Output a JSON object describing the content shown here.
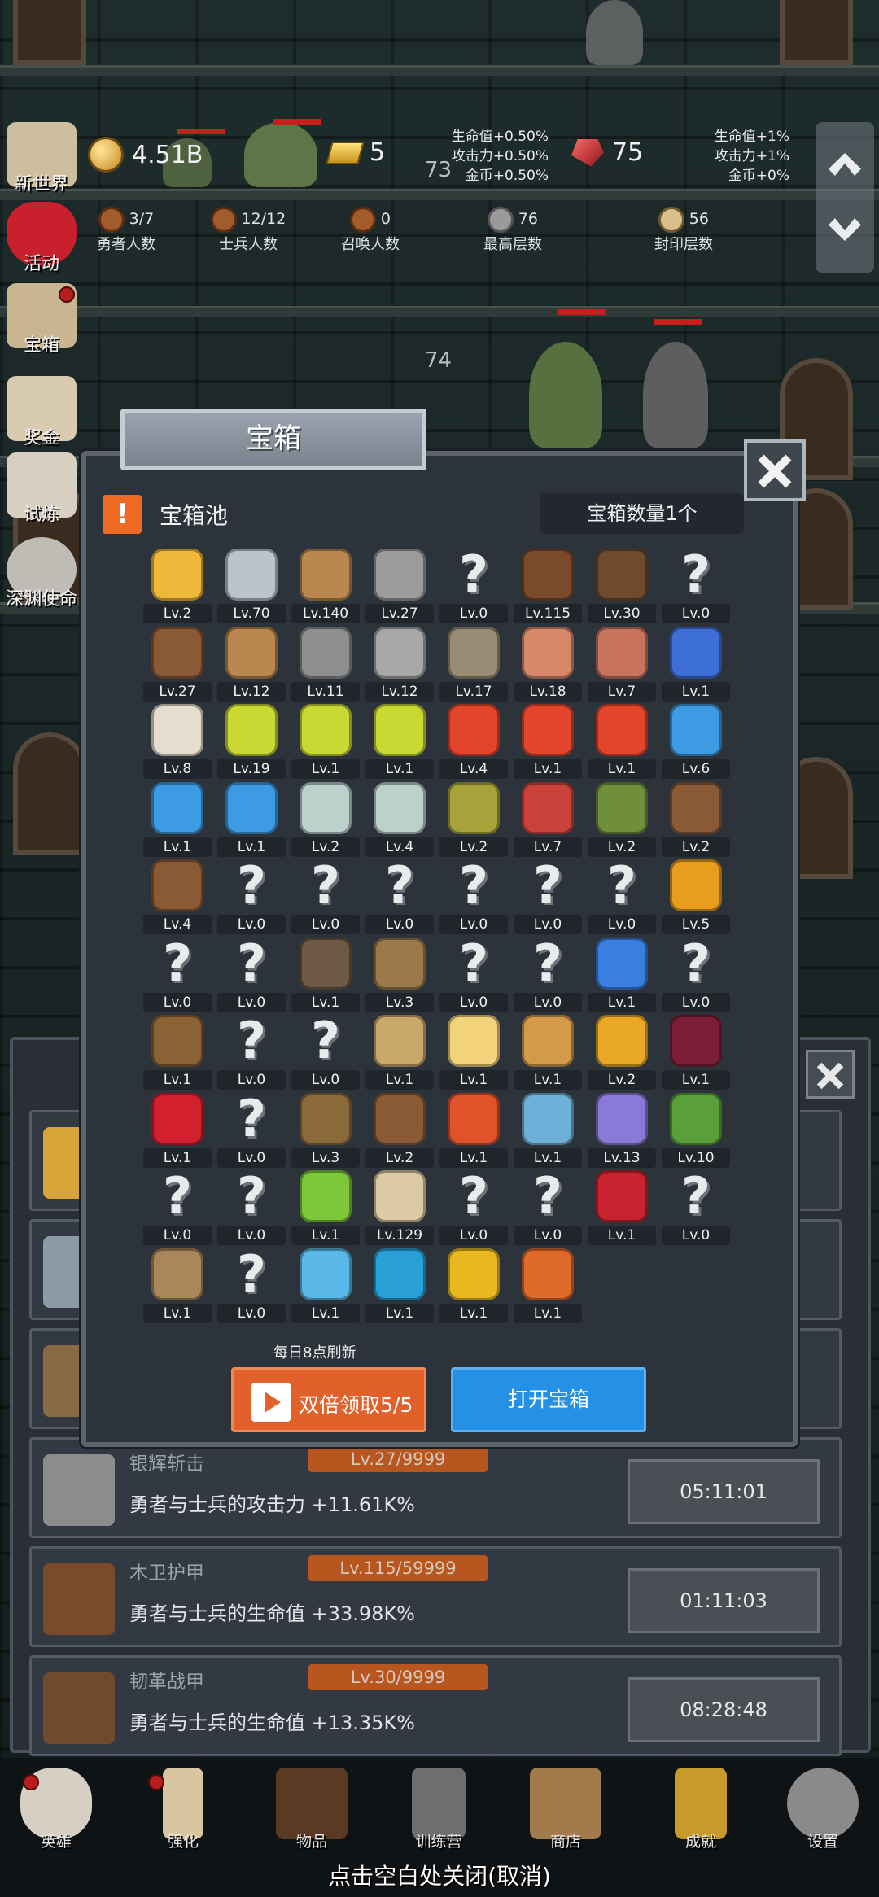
{
  "hud": {
    "gold": "4.51B",
    "gold_bar": "5",
    "gem": "75",
    "floor_top": "73",
    "floor_mid": "74",
    "buffs_left": [
      "生命值+0.50%",
      "攻击力+0.50%",
      "金币+0.50%"
    ],
    "buffs_right": [
      "生命值+1%",
      "攻击力+1%",
      "金币+0%"
    ],
    "stats": [
      {
        "label": "勇者人数",
        "value": "3/7"
      },
      {
        "label": "士兵人数",
        "value": "12/12"
      },
      {
        "label": "召唤人数",
        "value": "0"
      },
      {
        "label": "最高层数",
        "value": "76"
      },
      {
        "label": "封印层数",
        "value": "56"
      }
    ]
  },
  "side_menu": [
    "新世界",
    "活动",
    "宝箱",
    "奖金",
    "试炼",
    "深渊使命"
  ],
  "dialog": {
    "title": "宝箱",
    "pool_label": "宝箱池",
    "pool_icon": "!",
    "count_label": "宝箱数量1个",
    "refresh_note": "每日8点刷新",
    "double_button": "双倍领取5/5",
    "open_button": "打开宝箱",
    "items": [
      {
        "icon": "crown",
        "lv": "Lv.2"
      },
      {
        "icon": "diamond",
        "lv": "Lv.70"
      },
      {
        "icon": "wood-sword",
        "lv": "Lv.140"
      },
      {
        "icon": "silver-sword",
        "lv": "Lv.27"
      },
      {
        "icon": "unknown",
        "lv": "Lv.0"
      },
      {
        "icon": "wood-armor",
        "lv": "Lv.115"
      },
      {
        "icon": "leather-armor",
        "lv": "Lv.30"
      },
      {
        "icon": "unknown",
        "lv": "Lv.0"
      },
      {
        "icon": "leather-helmet",
        "lv": "Lv.27"
      },
      {
        "icon": "wood-sword",
        "lv": "Lv.12"
      },
      {
        "icon": "iron-helmet",
        "lv": "Lv.11"
      },
      {
        "icon": "hammer",
        "lv": "Lv.12"
      },
      {
        "icon": "knight-helmet",
        "lv": "Lv.17"
      },
      {
        "icon": "meat-leg",
        "lv": "Lv.18"
      },
      {
        "icon": "steak",
        "lv": "Lv.7"
      },
      {
        "icon": "blue-bag",
        "lv": "Lv.1"
      },
      {
        "icon": "bread",
        "lv": "Lv.8"
      },
      {
        "icon": "yellow-potion",
        "lv": "Lv.19"
      },
      {
        "icon": "yellow-potion",
        "lv": "Lv.1"
      },
      {
        "icon": "yellow-potion",
        "lv": "Lv.1"
      },
      {
        "icon": "red-potion",
        "lv": "Lv.4"
      },
      {
        "icon": "red-potion",
        "lv": "Lv.1"
      },
      {
        "icon": "red-potion",
        "lv": "Lv.1"
      },
      {
        "icon": "blue-potion",
        "lv": "Lv.6"
      },
      {
        "icon": "blue-potion",
        "lv": "Lv.1"
      },
      {
        "icon": "blue-potion",
        "lv": "Lv.1"
      },
      {
        "icon": "glass-bottle",
        "lv": "Lv.2"
      },
      {
        "icon": "glass-bottle",
        "lv": "Lv.4"
      },
      {
        "icon": "olive-bottle",
        "lv": "Lv.2"
      },
      {
        "icon": "red-bottle",
        "lv": "Lv.7"
      },
      {
        "icon": "winged-boot",
        "lv": "Lv.2"
      },
      {
        "icon": "leather-boot",
        "lv": "Lv.2"
      },
      {
        "icon": "leather-boot",
        "lv": "Lv.4"
      },
      {
        "icon": "unknown",
        "lv": "Lv.0"
      },
      {
        "icon": "unknown",
        "lv": "Lv.0"
      },
      {
        "icon": "unknown",
        "lv": "Lv.0"
      },
      {
        "icon": "unknown",
        "lv": "Lv.0"
      },
      {
        "icon": "unknown",
        "lv": "Lv.0"
      },
      {
        "icon": "unknown",
        "lv": "Lv.0"
      },
      {
        "icon": "torch",
        "lv": "Lv.5"
      },
      {
        "icon": "unknown",
        "lv": "Lv.0"
      },
      {
        "icon": "unknown",
        "lv": "Lv.0"
      },
      {
        "icon": "pickaxe",
        "lv": "Lv.1"
      },
      {
        "icon": "staff",
        "lv": "Lv.3"
      },
      {
        "icon": "unknown",
        "lv": "Lv.0"
      },
      {
        "icon": "unknown",
        "lv": "Lv.0"
      },
      {
        "icon": "blue-wand",
        "lv": "Lv.1"
      },
      {
        "icon": "unknown",
        "lv": "Lv.0"
      },
      {
        "icon": "backpack",
        "lv": "Lv.1"
      },
      {
        "icon": "unknown",
        "lv": "Lv.0"
      },
      {
        "icon": "unknown",
        "lv": "Lv.0"
      },
      {
        "icon": "broom",
        "lv": "Lv.1"
      },
      {
        "icon": "cheese",
        "lv": "Lv.1"
      },
      {
        "icon": "pie",
        "lv": "Lv.1"
      },
      {
        "icon": "honey-jar",
        "lv": "Lv.2"
      },
      {
        "icon": "dark-crystal",
        "lv": "Lv.1"
      },
      {
        "icon": "red-orb",
        "lv": "Lv.1"
      },
      {
        "icon": "unknown",
        "lv": "Lv.0"
      },
      {
        "icon": "bow",
        "lv": "Lv.3"
      },
      {
        "icon": "quiver",
        "lv": "Lv.2"
      },
      {
        "icon": "fire-gauntlet",
        "lv": "Lv.1"
      },
      {
        "icon": "ice-rune",
        "lv": "Lv.1"
      },
      {
        "icon": "tentacle-rune",
        "lv": "Lv.13"
      },
      {
        "icon": "green-emblem",
        "lv": "Lv.10"
      },
      {
        "icon": "unknown",
        "lv": "Lv.0"
      },
      {
        "icon": "unknown",
        "lv": "Lv.0"
      },
      {
        "icon": "green-scepter",
        "lv": "Lv.1"
      },
      {
        "icon": "beer-mug",
        "lv": "Lv.129"
      },
      {
        "icon": "unknown",
        "lv": "Lv.0"
      },
      {
        "icon": "unknown",
        "lv": "Lv.0"
      },
      {
        "icon": "red-book",
        "lv": "Lv.1"
      },
      {
        "icon": "unknown",
        "lv": "Lv.0"
      },
      {
        "icon": "whip",
        "lv": "Lv.1"
      },
      {
        "icon": "unknown",
        "lv": "Lv.0"
      },
      {
        "icon": "crystal-statue",
        "lv": "Lv.1"
      },
      {
        "icon": "blue-compass",
        "lv": "Lv.1"
      },
      {
        "icon": "golden-orb",
        "lv": "Lv.1"
      },
      {
        "icon": "fire-arrow",
        "lv": "Lv.1"
      }
    ]
  },
  "list": [
    {
      "icon": "silver-sword",
      "name": "银辉斩击",
      "level": "Lv.27/9999",
      "desc": "勇者与士兵的攻击力 +11.61K%",
      "timer": "05:11:01"
    },
    {
      "icon": "wood-armor",
      "name": "木卫护甲",
      "level": "Lv.115/59999",
      "desc": "勇者与士兵的生命值 +33.98K%",
      "timer": "01:11:03"
    },
    {
      "icon": "leather-armor",
      "name": "韧革战甲",
      "level": "Lv.30/9999",
      "desc": "勇者与士兵的生命值 +13.35K%",
      "timer": "08:28:48"
    }
  ],
  "bottom_nav": [
    "英雄",
    "强化",
    "物品",
    "训练营",
    "商店",
    "成就",
    "设置"
  ],
  "tap_close": "点击空白处关闭(取消)",
  "colors": {
    "orange_button": "#e2602a",
    "blue_button": "#2490e6",
    "level_tag": "#b7561f",
    "panel": "#2d333b"
  }
}
